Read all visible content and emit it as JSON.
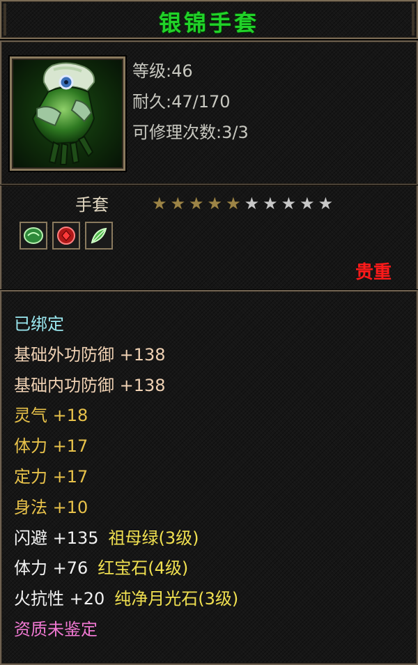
{
  "title": "银锦手套",
  "header": {
    "level_label": "等级:46",
    "durability_label": "耐久:47/170",
    "repairs_label": "可修理次数:3/3"
  },
  "item": {
    "category": "手套",
    "star_rating": {
      "filled": 5,
      "total": 10
    },
    "gem_icons": [
      "green-gem-icon",
      "red-gem-icon",
      "green-crystal-icon"
    ],
    "rarity": "贵重"
  },
  "properties": {
    "bound": "已绑定",
    "base_outer_def": "基础外功防御 +138",
    "base_inner_def": "基础内功防御 +138",
    "spirit": "灵气 +18",
    "stamina": "体力 +17",
    "focus": "定力 +17",
    "agility": "身法 +10",
    "dodge_value": "闪避 +135",
    "dodge_gem": "祖母绿(3级)",
    "stamina_gem_value": "体力 +76",
    "stamina_gem": "红宝石(4级)",
    "fire_res_value": "火抗性 +20",
    "fire_res_gem": "纯净月光石(3级)",
    "aptitude": "资质未鉴定"
  },
  "colors": {
    "title": "#21d229",
    "rarity": "#ff1a1a",
    "bound": "#9ae8f0",
    "attribute": "#e8c24a",
    "gem": "#f0e050",
    "aptitude": "#f078d2"
  }
}
